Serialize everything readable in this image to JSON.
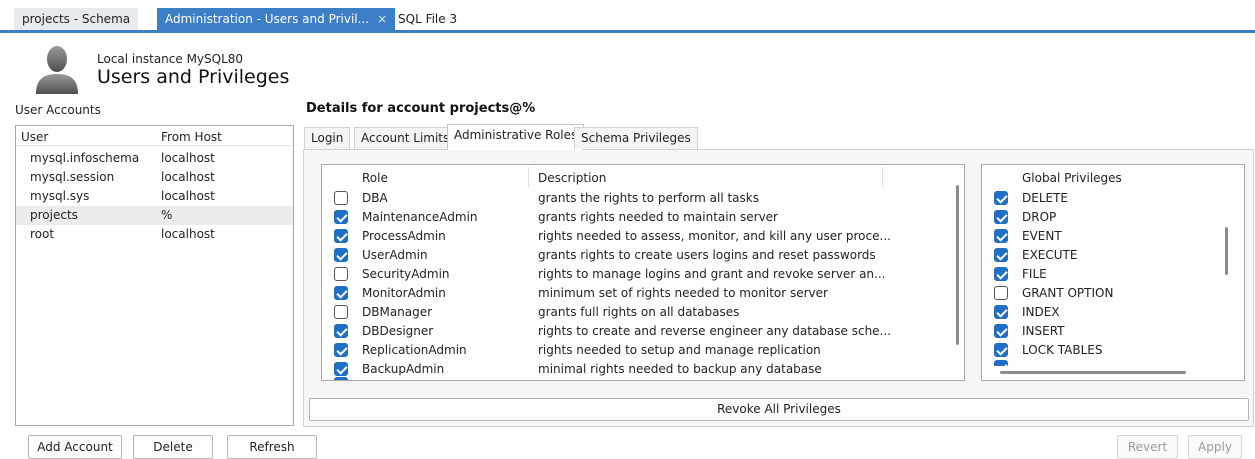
{
  "tabs": [
    {
      "label": "projects - Schema",
      "active": false
    },
    {
      "label": "Administration - Users and Privil...",
      "active": true,
      "close": "×"
    },
    {
      "label": "SQL File 3",
      "active": false
    }
  ],
  "header": {
    "instance": "Local instance MySQL80",
    "title": "Users and Privileges"
  },
  "user_accounts": {
    "label": "User Accounts",
    "columns": [
      "User",
      "From Host"
    ],
    "rows": [
      {
        "user": "mysql.infoschema",
        "host": "localhost"
      },
      {
        "user": "mysql.session",
        "host": "localhost"
      },
      {
        "user": "mysql.sys",
        "host": "localhost"
      },
      {
        "user": "projects",
        "host": "%"
      },
      {
        "user": "root",
        "host": "localhost"
      }
    ],
    "selected_index": 3
  },
  "details": {
    "title": "Details for account projects@%",
    "tabs": [
      "Login",
      "Account Limits",
      "Administrative Roles",
      "Schema Privileges"
    ],
    "active_tab": "Administrative Roles"
  },
  "roles": {
    "columns": [
      "Role",
      "Description"
    ],
    "rows": [
      {
        "checked": false,
        "role": "DBA",
        "desc": "grants the rights to perform all tasks"
      },
      {
        "checked": true,
        "role": "MaintenanceAdmin",
        "desc": "grants rights needed to maintain server"
      },
      {
        "checked": true,
        "role": "ProcessAdmin",
        "desc": "rights needed to assess, monitor, and kill any user proce..."
      },
      {
        "checked": true,
        "role": "UserAdmin",
        "desc": "grants rights to create users logins and reset passwords"
      },
      {
        "checked": false,
        "role": "SecurityAdmin",
        "desc": "rights to manage logins and grant and revoke server an..."
      },
      {
        "checked": true,
        "role": "MonitorAdmin",
        "desc": "minimum set of rights needed to monitor server"
      },
      {
        "checked": false,
        "role": "DBManager",
        "desc": "grants full rights on all databases"
      },
      {
        "checked": true,
        "role": "DBDesigner",
        "desc": "rights to create and reverse engineer any database sche..."
      },
      {
        "checked": true,
        "role": "ReplicationAdmin",
        "desc": "rights needed to setup and manage replication"
      },
      {
        "checked": true,
        "role": "BackupAdmin",
        "desc": "minimal rights needed to backup any database"
      }
    ]
  },
  "global_privileges": {
    "column": "Global Privileges",
    "rows": [
      {
        "checked": true,
        "name": "DELETE"
      },
      {
        "checked": true,
        "name": "DROP"
      },
      {
        "checked": true,
        "name": "EVENT"
      },
      {
        "checked": true,
        "name": "EXECUTE"
      },
      {
        "checked": true,
        "name": "FILE"
      },
      {
        "checked": false,
        "name": "GRANT OPTION"
      },
      {
        "checked": true,
        "name": "INDEX"
      },
      {
        "checked": true,
        "name": "INSERT"
      },
      {
        "checked": true,
        "name": "LOCK TABLES"
      }
    ]
  },
  "buttons": {
    "revoke_all": "Revoke All Privileges",
    "add_account": "Add Account",
    "delete": "Delete",
    "refresh": "Refresh",
    "revert": "Revert",
    "apply": "Apply"
  }
}
